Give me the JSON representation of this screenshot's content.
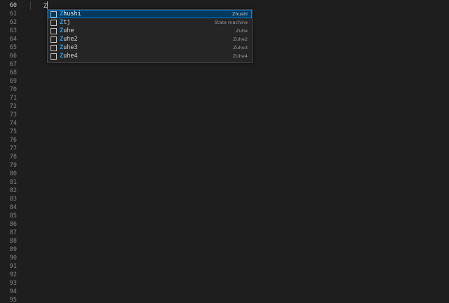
{
  "editor": {
    "line_numbers": [
      "60",
      "61",
      "62",
      "63",
      "64",
      "65",
      "66",
      "67",
      "68",
      "69",
      "70",
      "71",
      "72",
      "73",
      "74",
      "75",
      "76",
      "77",
      "78",
      "79",
      "80",
      "81",
      "82",
      "83",
      "84",
      "85",
      "86",
      "87",
      "88",
      "89",
      "90",
      "91",
      "92",
      "93",
      "94",
      "95"
    ],
    "active_line": "60",
    "current_line_text": "Z"
  },
  "suggestions": {
    "typed_prefix": "Z",
    "selected_index": 0,
    "items": [
      {
        "label": "Zhushi",
        "match": "Z",
        "rest": "hushi",
        "detail": "Zhushi",
        "icon": "snippet-icon"
      },
      {
        "label": "Ztj",
        "match": "Z",
        "rest": "tj",
        "detail": "State machine",
        "icon": "snippet-icon"
      },
      {
        "label": "Zuhe",
        "match": "Z",
        "rest": "uhe",
        "detail": "Zuhe",
        "icon": "snippet-icon"
      },
      {
        "label": "Zuhe2",
        "match": "Z",
        "rest": "uhe2",
        "detail": "Zuhe2",
        "icon": "snippet-icon"
      },
      {
        "label": "Zuhe3",
        "match": "Z",
        "rest": "uhe3",
        "detail": "Zuhe3",
        "icon": "snippet-icon"
      },
      {
        "label": "Zuhe4",
        "match": "Z",
        "rest": "uhe4",
        "detail": "Zuhe4",
        "icon": "snippet-icon"
      }
    ]
  },
  "colors": {
    "background": "#1e1e1e",
    "line_number": "#858585",
    "widget_background": "#252526",
    "selection": "#04395e",
    "match_highlight": "#18a3ff"
  }
}
